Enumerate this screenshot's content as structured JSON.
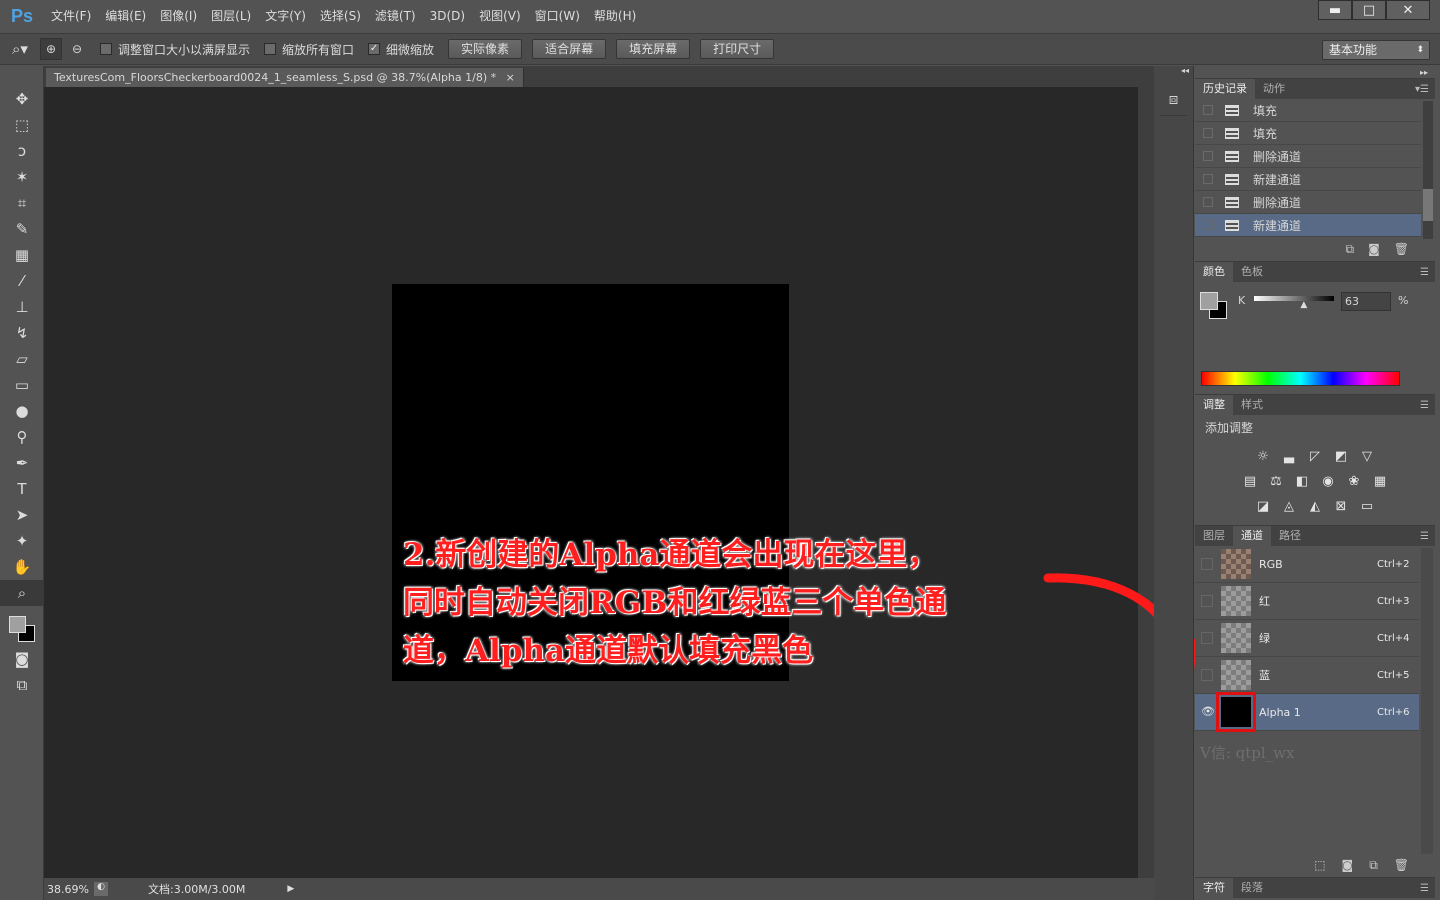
{
  "app": {
    "logo": "Ps"
  },
  "menu": [
    "文件(F)",
    "编辑(E)",
    "图像(I)",
    "图层(L)",
    "文字(Y)",
    "选择(S)",
    "滤镜(T)",
    "3D(D)",
    "视图(V)",
    "窗口(W)",
    "帮助(H)"
  ],
  "window_controls": {
    "minimize": "▬",
    "maximize": "□",
    "close": "✕"
  },
  "options": {
    "tool_icon": "zoom-icon",
    "checkbox1": "调整窗口大小以满屏显示",
    "checkbox2": "缩放所有窗口",
    "checkbox3": "细微缩放",
    "checkbox3_checked": true,
    "btn_actual": "实际像素",
    "btn_fit": "适合屏幕",
    "btn_fill": "填充屏幕",
    "btn_print": "打印尺寸",
    "workspace": "基本功能"
  },
  "document": {
    "tab_title": "TexturesCom_FloorsCheckerboard0024_1_seamless_S.psd @ 38.7%(Alpha 1/8) *",
    "tab_close": "×",
    "zoom": "38.69%",
    "doc_size": "文档:3.00M/3.00M",
    "image_color": "#000000"
  },
  "annotation": {
    "line1": "2.新创建的Alpha通道会出现在这里，",
    "line2": "同时自动关闭RGB和红绿蓝三个单色通",
    "line3": "道，Alpha通道默认填充黑色",
    "color": "#ff1f1f",
    "watermark": "V信: qtpl_wx"
  },
  "history_panel": {
    "tabs": [
      "历史记录",
      "动作"
    ],
    "items": [
      {
        "label": "填充"
      },
      {
        "label": "填充"
      },
      {
        "label": "删除通道"
      },
      {
        "label": "新建通道"
      },
      {
        "label": "删除通道"
      },
      {
        "label": "新建通道",
        "selected": true
      }
    ]
  },
  "color_panel": {
    "tabs": [
      "颜色",
      "色板"
    ],
    "channel_label": "K",
    "value": "63",
    "unit": "%",
    "slider_fraction": 0.63
  },
  "adjust_panel": {
    "tabs": [
      "调整",
      "样式"
    ],
    "title": "添加调整"
  },
  "channels_panel": {
    "tabs": [
      "图层",
      "通道",
      "路径"
    ],
    "channels": [
      {
        "name": "RGB",
        "shortcut": "Ctrl+2"
      },
      {
        "name": "红",
        "shortcut": "Ctrl+3"
      },
      {
        "name": "绿",
        "shortcut": "Ctrl+4"
      },
      {
        "name": "蓝",
        "shortcut": "Ctrl+5"
      },
      {
        "name": "Alpha 1",
        "shortcut": "Ctrl+6",
        "selected": true
      }
    ]
  },
  "bottom_panel": {
    "tabs": [
      "字符",
      "段落"
    ]
  }
}
